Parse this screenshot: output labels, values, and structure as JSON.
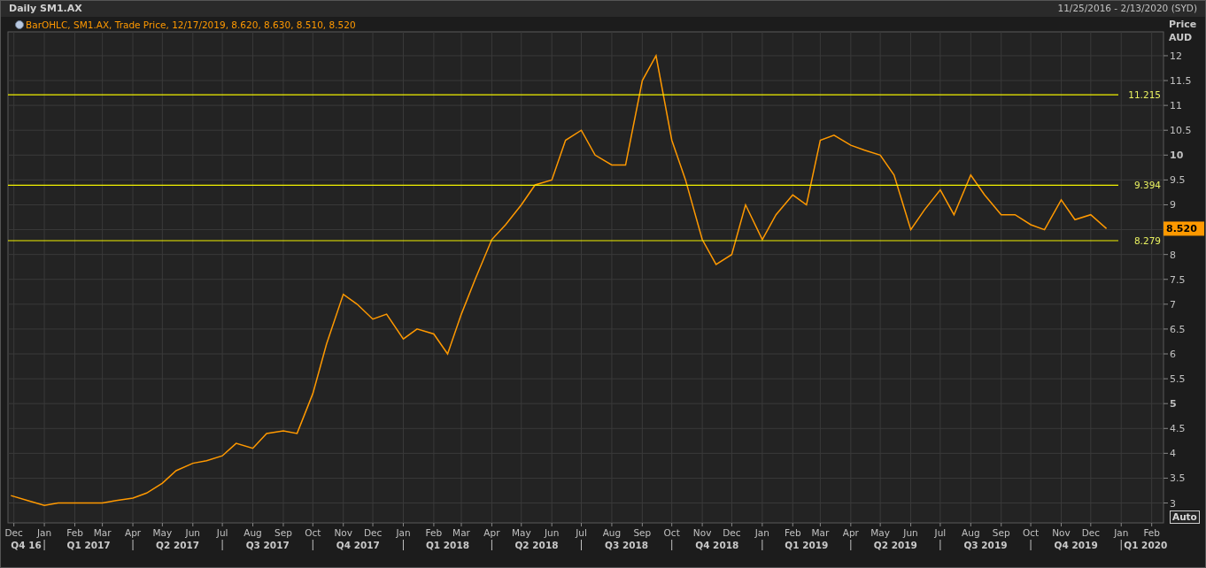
{
  "header": {
    "title": "Daily SM1.AX",
    "date_range": "11/25/2016 - 2/13/2020 (SYD)"
  },
  "legend": "BarOHLC, SM1.AX, Trade Price, 12/17/2019, 8.620, 8.630, 8.510, 8.520",
  "axis_title": [
    "Price",
    "AUD"
  ],
  "last_price": "8.520",
  "auto_button": "Auto",
  "chart_data": {
    "type": "line",
    "x": [
      "2016-11-28",
      "2016-12-15",
      "2017-01-01",
      "2017-01-15",
      "2017-02-01",
      "2017-02-15",
      "2017-03-01",
      "2017-03-15",
      "2017-04-01",
      "2017-04-15",
      "2017-05-01",
      "2017-05-15",
      "2017-06-01",
      "2017-06-15",
      "2017-07-01",
      "2017-07-15",
      "2017-08-01",
      "2017-08-15",
      "2017-09-01",
      "2017-09-15",
      "2017-10-01",
      "2017-10-15",
      "2017-11-01",
      "2017-11-15",
      "2017-12-01",
      "2017-12-15",
      "2018-01-01",
      "2018-01-15",
      "2018-02-01",
      "2018-02-15",
      "2018-03-01",
      "2018-03-15",
      "2018-04-01",
      "2018-04-15",
      "2018-05-01",
      "2018-05-15",
      "2018-06-01",
      "2018-06-15",
      "2018-07-01",
      "2018-07-15",
      "2018-08-01",
      "2018-08-15",
      "2018-09-01",
      "2018-09-15",
      "2018-10-01",
      "2018-10-15",
      "2018-11-01",
      "2018-11-15",
      "2018-12-01",
      "2018-12-15",
      "2019-01-01",
      "2019-01-15",
      "2019-02-01",
      "2019-02-15",
      "2019-03-01",
      "2019-03-15",
      "2019-04-01",
      "2019-04-15",
      "2019-05-01",
      "2019-05-15",
      "2019-06-01",
      "2019-06-15",
      "2019-07-01",
      "2019-07-15",
      "2019-08-01",
      "2019-08-15",
      "2019-09-01",
      "2019-09-15",
      "2019-10-01",
      "2019-10-15",
      "2019-11-01",
      "2019-11-15",
      "2019-12-01",
      "2019-12-17"
    ],
    "series": [
      {
        "color": "#ff9900",
        "values": [
          3.15,
          3.05,
          2.95,
          3.0,
          3.0,
          3.0,
          3.0,
          3.05,
          3.1,
          3.2,
          3.4,
          3.65,
          3.8,
          3.85,
          3.95,
          4.2,
          4.1,
          4.4,
          4.45,
          4.4,
          5.2,
          6.2,
          7.2,
          7.0,
          6.7,
          6.8,
          6.3,
          6.5,
          6.4,
          6.0,
          6.8,
          7.5,
          8.3,
          8.6,
          9.0,
          9.4,
          9.5,
          10.3,
          10.5,
          10.0,
          9.8,
          9.8,
          11.5,
          12.0,
          10.3,
          9.5,
          8.3,
          7.8,
          8.0,
          9.0,
          8.3,
          8.8,
          9.2,
          9.0,
          10.3,
          10.4,
          10.2,
          10.1,
          10.0,
          9.6,
          8.5,
          8.9,
          9.3,
          8.8,
          9.6,
          9.2,
          8.8,
          8.8,
          8.6,
          8.5,
          9.1,
          8.7,
          8.8,
          8.52
        ]
      }
    ],
    "xlim": [
      "2016-11-25",
      "2020-02-13"
    ],
    "ylim": [
      2.6,
      12.48
    ],
    "grid": true,
    "yticks": [
      3,
      3.5,
      4,
      4.5,
      5,
      5.5,
      6,
      6.5,
      7,
      7.5,
      8,
      9,
      9.5,
      10,
      10.5,
      11,
      11.5,
      12
    ],
    "xticks": [
      {
        "value": "2016-12-01",
        "label": "Dec"
      },
      {
        "value": "2017-01-01",
        "label": "Jan"
      },
      {
        "value": "2017-02-01",
        "label": "Feb"
      },
      {
        "value": "2017-03-01",
        "label": "Mar"
      },
      {
        "value": "2017-04-01",
        "label": "Apr"
      },
      {
        "value": "2017-05-01",
        "label": "May"
      },
      {
        "value": "2017-06-01",
        "label": "Jun"
      },
      {
        "value": "2017-07-01",
        "label": "Jul"
      },
      {
        "value": "2017-08-01",
        "label": "Aug"
      },
      {
        "value": "2017-09-01",
        "label": "Sep"
      },
      {
        "value": "2017-10-01",
        "label": "Oct"
      },
      {
        "value": "2017-11-01",
        "label": "Nov"
      },
      {
        "value": "2017-12-01",
        "label": "Dec"
      },
      {
        "value": "2018-01-01",
        "label": "Jan"
      },
      {
        "value": "2018-02-01",
        "label": "Feb"
      },
      {
        "value": "2018-03-01",
        "label": "Mar"
      },
      {
        "value": "2018-04-01",
        "label": "Apr"
      },
      {
        "value": "2018-05-01",
        "label": "May"
      },
      {
        "value": "2018-06-01",
        "label": "Jun"
      },
      {
        "value": "2018-07-01",
        "label": "Jul"
      },
      {
        "value": "2018-08-01",
        "label": "Aug"
      },
      {
        "value": "2018-09-01",
        "label": "Sep"
      },
      {
        "value": "2018-10-01",
        "label": "Oct"
      },
      {
        "value": "2018-11-01",
        "label": "Nov"
      },
      {
        "value": "2018-12-01",
        "label": "Dec"
      },
      {
        "value": "2019-01-01",
        "label": "Jan"
      },
      {
        "value": "2019-02-01",
        "label": "Feb"
      },
      {
        "value": "2019-03-01",
        "label": "Mar"
      },
      {
        "value": "2019-04-01",
        "label": "Apr"
      },
      {
        "value": "2019-05-01",
        "label": "May"
      },
      {
        "value": "2019-06-01",
        "label": "Jun"
      },
      {
        "value": "2019-07-01",
        "label": "Jul"
      },
      {
        "value": "2019-08-01",
        "label": "Aug"
      },
      {
        "value": "2019-09-01",
        "label": "Sep"
      },
      {
        "value": "2019-10-01",
        "label": "Oct"
      },
      {
        "value": "2019-11-01",
        "label": "Nov"
      },
      {
        "value": "2019-12-01",
        "label": "Dec"
      },
      {
        "value": "2020-01-01",
        "label": "Jan"
      },
      {
        "value": "2020-02-01",
        "label": "Feb"
      }
    ],
    "ref_lines": [
      {
        "axis": "y",
        "value": 11.215,
        "label": "11.215"
      },
      {
        "axis": "y",
        "value": 9.394,
        "label": "9.394"
      },
      {
        "axis": "y",
        "value": 8.279,
        "label": "8.279"
      }
    ]
  },
  "quarters": [
    "Q4 16",
    "Q1 2017",
    "Q2 2017",
    "Q3 2017",
    "Q4 2017",
    "Q1 2018",
    "Q2 2018",
    "Q3 2018",
    "Q4 2018",
    "Q1 2019",
    "Q2 2019",
    "Q3 2019",
    "Q4 2019",
    "Q1 2020"
  ]
}
